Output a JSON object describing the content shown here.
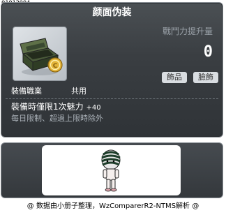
{
  "item_id": "01012004",
  "tooltip": {
    "title": "颜面伪装",
    "stat_label": "戰鬥力提升量",
    "stat_value": "0",
    "tags": [
      "飾品",
      "臉飾"
    ],
    "job_label": "裝備職業",
    "job_value": "共用",
    "effect_line": "裝備時僅限1次魅力",
    "effect_bonus": "+40",
    "limit_line": "每日限制、超過上限時除外"
  },
  "footer": {
    "text": "@ 数据由小册子整理，WzComparerR2-NTMS解析 @"
  },
  "icons": {
    "item": "green-box-with-gold-coin",
    "avatar": "character-preview"
  },
  "colors": {
    "panel_bg": "#3a3e42",
    "title_text": "#ffffff",
    "muted_text": "#aab1b8",
    "tag_bg": "#d9dde1"
  }
}
